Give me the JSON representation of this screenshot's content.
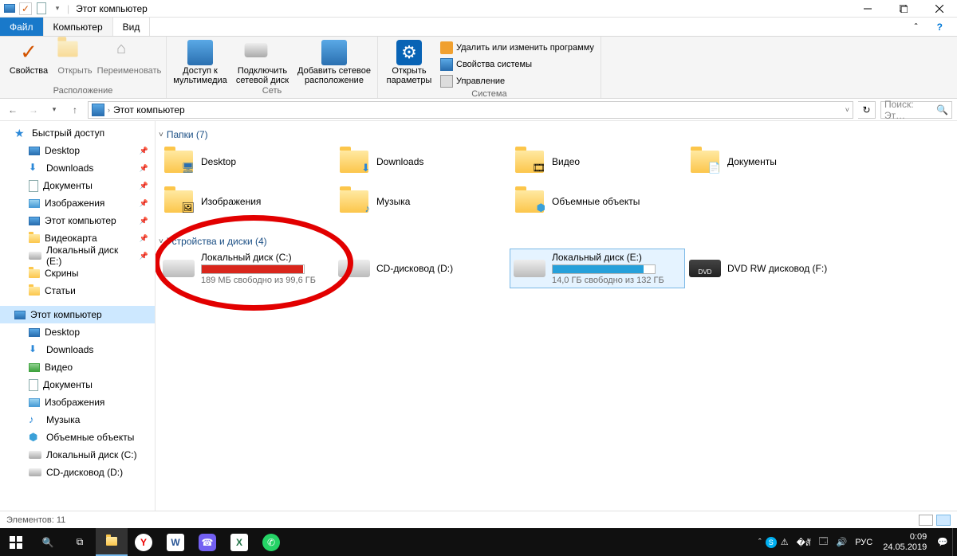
{
  "title": "Этот компьютер",
  "tabs": {
    "file": "Файл",
    "computer": "Компьютер",
    "view": "Вид"
  },
  "ribbon": {
    "loc": {
      "props": "Свойства",
      "open": "Открыть",
      "rename": "Переименовать",
      "caption": "Расположение"
    },
    "net": {
      "media": "Доступ к\nмультимедиа",
      "map": "Подключить\nсетевой диск",
      "add": "Добавить сетевое\nрасположение",
      "caption": "Сеть"
    },
    "sys": {
      "open_params": "Открыть\nпараметры",
      "uninstall": "Удалить или изменить программу",
      "sysprops": "Свойства системы",
      "manage": "Управление",
      "caption": "Система"
    }
  },
  "breadcrumb": "Этот компьютер",
  "search_placeholder": "Поиск: Эт…",
  "nav": {
    "quick": "Быстрый доступ",
    "desktop": "Desktop",
    "downloads": "Downloads",
    "documents": "Документы",
    "pictures": "Изображения",
    "thispc_q": "Этот компьютер",
    "videocard": "Видеокарта",
    "localE_q": "Локальный диск (E:)",
    "screens": "Скрины",
    "articles": "Статьи",
    "thispc": "Этот компьютер",
    "desktop2": "Desktop",
    "downloads2": "Downloads",
    "video2": "Видео",
    "documents2": "Документы",
    "pictures2": "Изображения",
    "music2": "Музыка",
    "objects": "Объемные объекты",
    "localC": "Локальный диск (C:)",
    "cdD": "CD-дисковод (D:)"
  },
  "sections": {
    "folders": {
      "title": "Папки (7)"
    },
    "devices": {
      "title": "Устройства и диски (4)"
    }
  },
  "folders": [
    {
      "name": "Desktop",
      "kind": "desktop"
    },
    {
      "name": "Downloads",
      "kind": "downloads"
    },
    {
      "name": "Видео",
      "kind": "video"
    },
    {
      "name": "Документы",
      "kind": "documents"
    },
    {
      "name": "Изображения",
      "kind": "pictures"
    },
    {
      "name": "Музыка",
      "kind": "music"
    },
    {
      "name": "Объемные объекты",
      "kind": "objects"
    }
  ],
  "devices": [
    {
      "name": "Локальный диск (C:)",
      "sub": "189 МБ свободно из 99,6 ГБ",
      "fill": 99,
      "color": "#d9261c",
      "kind": "hdd"
    },
    {
      "name": "CD-дисковод (D:)",
      "kind": "cd"
    },
    {
      "name": "Локальный диск (E:)",
      "sub": "14,0 ГБ свободно из 132 ГБ",
      "fill": 89,
      "color": "#26a0da",
      "kind": "hdd",
      "selected": true
    },
    {
      "name": "DVD RW дисковод (F:)",
      "kind": "dvd"
    }
  ],
  "status": "Элементов: 11",
  "tray": {
    "lang": "РУС",
    "time": "0:09",
    "date": "24.05.2019"
  }
}
